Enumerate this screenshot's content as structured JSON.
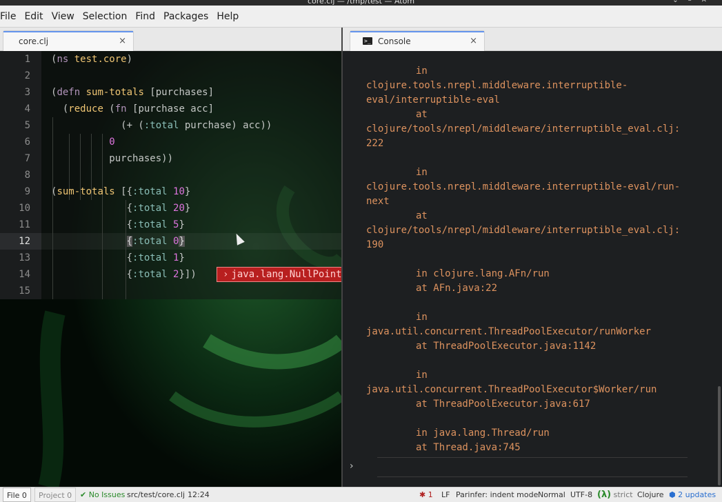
{
  "window": {
    "title": "core.clj — /tmp/test — Atom",
    "controls": [
      "⌄",
      "–",
      "✕"
    ]
  },
  "menu": [
    "File",
    "Edit",
    "View",
    "Selection",
    "Find",
    "Packages",
    "Help"
  ],
  "tabs": {
    "left": {
      "label": "core.clj",
      "close": "×"
    },
    "right": {
      "label": "Console",
      "icon": ">_",
      "close": "×"
    }
  },
  "editor": {
    "line_numbers": [
      "1",
      "2",
      "3",
      "4",
      "5",
      "6",
      "7",
      "8",
      "9",
      "10",
      "11",
      "12",
      "13",
      "14",
      "15"
    ],
    "active_line": "12",
    "error_badge": {
      "chevron": "›",
      "text": "java.lang.NullPointerException"
    },
    "code": {
      "l1": {
        "open": "(",
        "kw": "ns",
        "name": " test.core",
        "close": ")"
      },
      "l3": {
        "open": "(",
        "kw": "defn",
        "name": " sum-totals",
        "rest": " [purchases]"
      },
      "l4": {
        "lead": "  (",
        "kw": "reduce",
        "rest": " (",
        "kw2": "fn",
        "rest2": " [purchase acc]"
      },
      "l5": {
        "lead": "            (+ (",
        "kwd": ":total",
        "rest": " purchase) acc))"
      },
      "l6": {
        "lead": "          ",
        "num": "0"
      },
      "l7": {
        "lead": "          ",
        "rest": "purchases))"
      },
      "l9": {
        "open": "(",
        "fn": "sum-totals",
        "rest": " [{",
        "kwd": ":total",
        "sp": " ",
        "num": "10",
        "close": "}"
      },
      "l10": {
        "lead": "             {",
        "kwd": ":total",
        "sp": " ",
        "num": "20",
        "close": "}"
      },
      "l11": {
        "lead": "             {",
        "kwd": ":total",
        "sp": " ",
        "num": "5",
        "close": "}"
      },
      "l12": {
        "lead": "             ",
        "brace": "{",
        "kwd": ":total",
        "sp": " ",
        "num": "0",
        "close": "}"
      },
      "l13": {
        "lead": "             {",
        "kwd": ":total",
        "sp": " ",
        "num": "1",
        "close": "}"
      },
      "l14": {
        "lead": "             {",
        "kwd": ":total",
        "sp": " ",
        "num": "2",
        "close": "}])"
      }
    }
  },
  "console": {
    "lines": [
      {
        "indent": true,
        "text": "in"
      },
      {
        "indent": false,
        "text": "clojure.tools.nrepl.middleware.interruptible-"
      },
      {
        "indent": false,
        "text": "eval/interruptible-eval"
      },
      {
        "indent": true,
        "text": "at"
      },
      {
        "indent": false,
        "text": "clojure/tools/nrepl/middleware/interruptible_eval.clj:"
      },
      {
        "indent": false,
        "text": "222"
      },
      {
        "indent": true,
        "text": ""
      },
      {
        "indent": true,
        "text": "in"
      },
      {
        "indent": false,
        "text": "clojure.tools.nrepl.middleware.interruptible-eval/run-"
      },
      {
        "indent": false,
        "text": "next"
      },
      {
        "indent": true,
        "text": "at"
      },
      {
        "indent": false,
        "text": "clojure/tools/nrepl/middleware/interruptible_eval.clj:"
      },
      {
        "indent": false,
        "text": "190"
      },
      {
        "indent": true,
        "text": ""
      },
      {
        "indent": true,
        "text": "in clojure.lang.AFn/run"
      },
      {
        "indent": true,
        "text": "at AFn.java:22"
      },
      {
        "indent": true,
        "text": ""
      },
      {
        "indent": true,
        "text": "in"
      },
      {
        "indent": false,
        "text": "java.util.concurrent.ThreadPoolExecutor/runWorker"
      },
      {
        "indent": true,
        "text": "at ThreadPoolExecutor.java:1142"
      },
      {
        "indent": true,
        "text": ""
      },
      {
        "indent": true,
        "text": "in"
      },
      {
        "indent": false,
        "text": "java.util.concurrent.ThreadPoolExecutor$Worker/run"
      },
      {
        "indent": true,
        "text": "at ThreadPoolExecutor.java:617"
      },
      {
        "indent": true,
        "text": ""
      },
      {
        "indent": true,
        "text": "in java.lang.Thread/run"
      },
      {
        "indent": true,
        "text": "at Thread.java:745"
      }
    ],
    "prompt": "›"
  },
  "status": {
    "file": "File 0",
    "project": "Project 0",
    "check": "✔",
    "no_issues": "No Issues",
    "path": "src/test/core.clj",
    "position": "12:24",
    "bug_icon": "✱",
    "bug_count": "1",
    "line_ending": "LF",
    "parinfer": "Parinfer: indent mode",
    "mode": "Normal",
    "encoding": "UTF-8",
    "lambda": "(λ)",
    "strict": "strict",
    "grammar": "Clojure",
    "updates_icon": "⬢",
    "updates": "2 updates"
  },
  "colors": {
    "accent": "#6494ed",
    "error": "#b81f1f",
    "console_text": "#de935f",
    "ok": "#2a8a2a"
  }
}
